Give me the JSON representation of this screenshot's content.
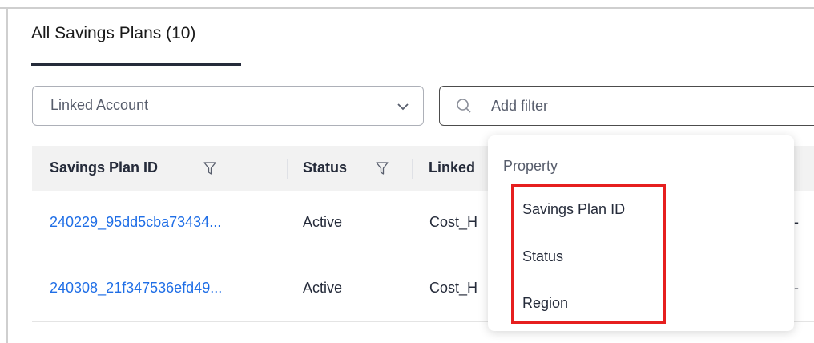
{
  "tabs": {
    "active_label": "All Savings Plans (10)"
  },
  "filters": {
    "linked_account_placeholder": "Linked Account",
    "search_placeholder": "Add filter"
  },
  "table": {
    "columns": [
      "Savings Plan ID",
      "Status",
      "Linked"
    ],
    "rows": [
      {
        "id": "240229_95dd5cba73434...",
        "status": "Active",
        "linked": "Cost_H",
        "trailing": "th-"
      },
      {
        "id": "240308_21f347536efd49...",
        "status": "Active",
        "linked": "Cost_H",
        "trailing": "th-"
      }
    ]
  },
  "dropdown": {
    "title": "Property",
    "options": [
      "Savings Plan ID",
      "Status",
      "Region"
    ]
  },
  "colors": {
    "link": "#1f6ee6",
    "highlight": "#e61f1f",
    "header_bg": "#f2f2f2"
  }
}
